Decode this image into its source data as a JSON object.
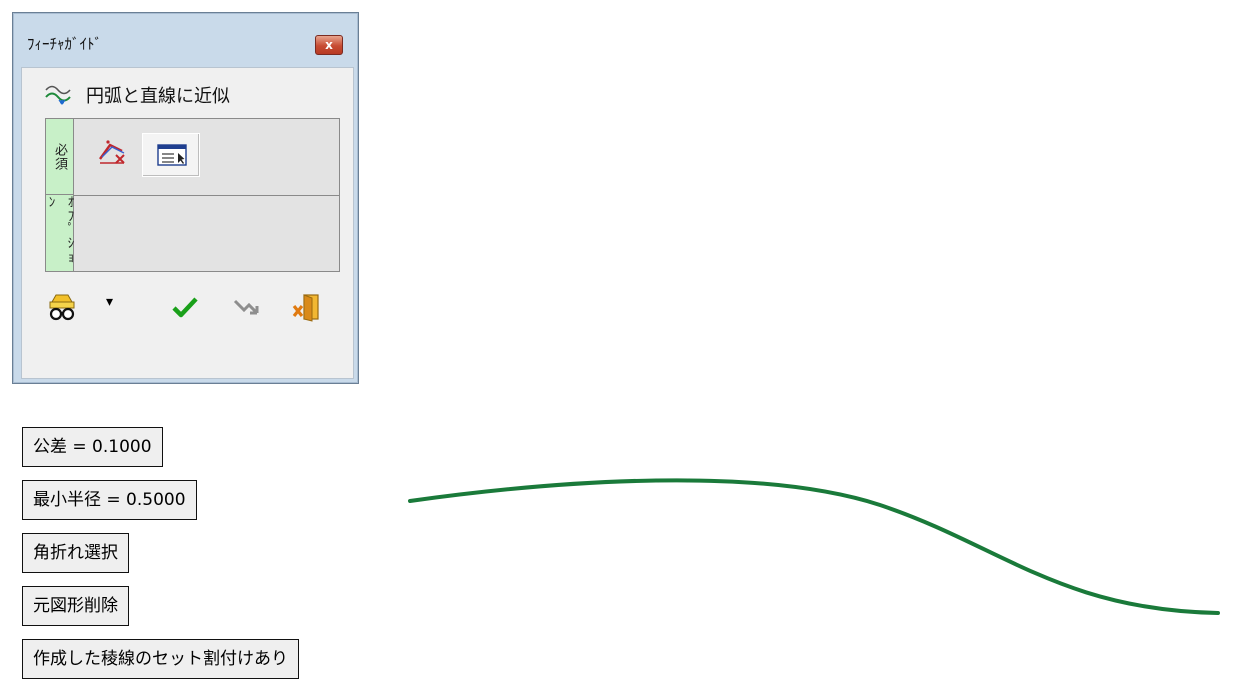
{
  "window": {
    "title": "ﾌｨｰﾁｬｶﾞｲﾄﾞ",
    "close_glyph": "x",
    "command_label": "円弧と直線に近似",
    "section_required": "必須",
    "section_option": "ｵﾌﾟｼｮﾝ",
    "dropdown_glyph": "▾"
  },
  "parameters": [
    {
      "label": "公差 =  0.1000"
    },
    {
      "label": "最小半径 =  0.5000"
    },
    {
      "label": "角折れ選択"
    },
    {
      "label": "元図形削除"
    },
    {
      "label": "作成した稜線のセット割付けあり"
    }
  ],
  "colors": {
    "curve": "#1a7a3a",
    "ok_check": "#1aa01a",
    "close_button": "#c74c33",
    "section_tab": "#c8f0c8"
  },
  "icons": {
    "command": "approximate-curve-icon",
    "required_a": "select-curve-icon",
    "required_b": "select-window-icon",
    "guide": "glasses-guide-icon",
    "ok": "check-icon",
    "back": "back-arrow-icon",
    "exit": "exit-door-icon"
  }
}
